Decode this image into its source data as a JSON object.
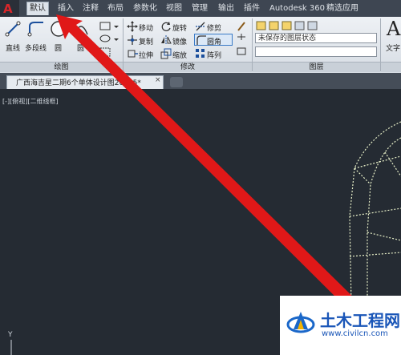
{
  "menubar": {
    "tabs": [
      "默认",
      "插入",
      "注释",
      "布局",
      "参数化",
      "视图",
      "管理",
      "输出",
      "插件",
      "Autodesk 360",
      "精选应用"
    ]
  },
  "ribbon": {
    "draw": {
      "line": "直线",
      "polyline": "多段线",
      "circle": "圆",
      "arc": "圆",
      "panel_title": "绘图"
    },
    "modify": {
      "move": "移动",
      "rotate": "旋转",
      "trim": "修剪",
      "copy": "复制",
      "mirror": "镜像",
      "fillet": "圆角",
      "stretch": "拉伸",
      "scale": "缩放",
      "array": "阵列",
      "panel_title": "修改"
    },
    "layers": {
      "current_state": "未保存的图层状态",
      "panel_title": "图层"
    },
    "text_label": "文字"
  },
  "document": {
    "tab_title": "广西海吉星二期6个单体设计图20",
    "tab_title_tail": "715*",
    "close_symbol": "×"
  },
  "canvas": {
    "viewport_label": "[-][俯视][二维线框]",
    "axis_label": "Y"
  },
  "watermark": {
    "name": "土木工程网",
    "url": "www.civilcn.com"
  },
  "colors": {
    "canvas": "#252b33",
    "annotation_arrow": "#e01818",
    "drawing_lines": "#e8f0c8"
  },
  "icons": [
    "autocad-logo-icon",
    "line-icon",
    "polyline-icon",
    "circle-icon",
    "arc-icon",
    "move-icon",
    "rotate-icon",
    "trim-icon",
    "copy-icon",
    "mirror-icon",
    "fillet-icon",
    "stretch-icon",
    "scale-icon",
    "array-icon",
    "layer-icon",
    "paint-icon",
    "text-icon"
  ]
}
